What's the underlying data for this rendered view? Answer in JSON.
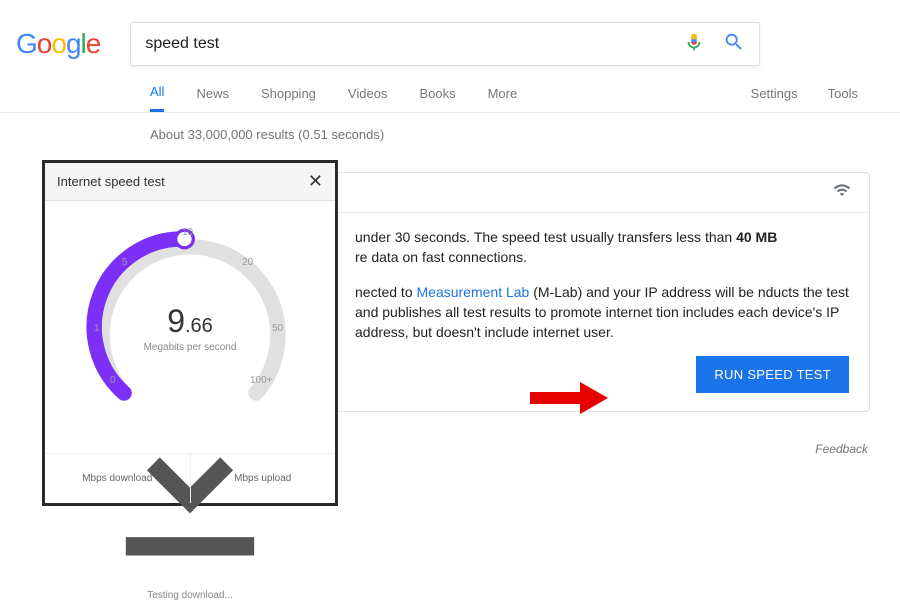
{
  "search": {
    "query": "speed test"
  },
  "tabs": {
    "all": "All",
    "news": "News",
    "shopping": "Shopping",
    "videos": "Videos",
    "books": "Books",
    "more": "More",
    "settings": "Settings",
    "tools": "Tools"
  },
  "meta": {
    "results": "About 33,000,000 results (0.51 seconds)"
  },
  "card": {
    "p1_a": " under 30 seconds. The speed test usually transfers less than ",
    "p1_bold": "40 MB",
    "p1_b": "re data on fast connections.",
    "p2_a": "nected to ",
    "p2_link": "Measurement Lab",
    "p2_b": " (M-Lab) and your IP address will be nducts the test and publishes all test results to promote internet tion includes each device's IP address, but doesn't include internet user.",
    "button": "RUN SPEED TEST",
    "feedback": "Feedback"
  },
  "overlay": {
    "title": "Internet speed test",
    "value_int": "9",
    "value_dec": ".66",
    "unit": "Megabits per second",
    "status": "Testing download...",
    "ticks": {
      "t0": "0",
      "t1": "1",
      "t5": "5",
      "t10": "10",
      "t20": "20",
      "t50": "50",
      "t100": "100+"
    },
    "footer_dl": "Mbps download",
    "footer_ul": "Mbps upload"
  }
}
